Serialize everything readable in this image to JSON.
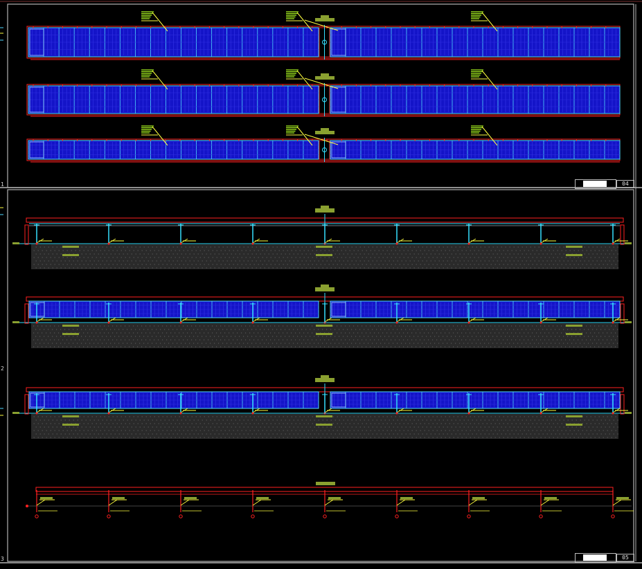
{
  "sheets": [
    {
      "index_label": "1",
      "sheet_number": "04"
    },
    {
      "index_label": "2",
      "sheet_number": ""
    },
    {
      "index_label": "3",
      "sheet_number": "05"
    }
  ],
  "colors": {
    "background": "#000000",
    "frame": "#b4b4b4",
    "panel_fill": "#1414c8",
    "panel_edge": "#4fd7ff",
    "red": "#ff2020",
    "cyan": "#35e0ff",
    "yellow": "#ffff40",
    "green_label": "#a6f020",
    "olive": "#8aa030",
    "ground": "#2a2a2a"
  },
  "drawing": {
    "top_rows": 3,
    "panel_modules_per_half": 19,
    "elevation_columns": 9
  }
}
